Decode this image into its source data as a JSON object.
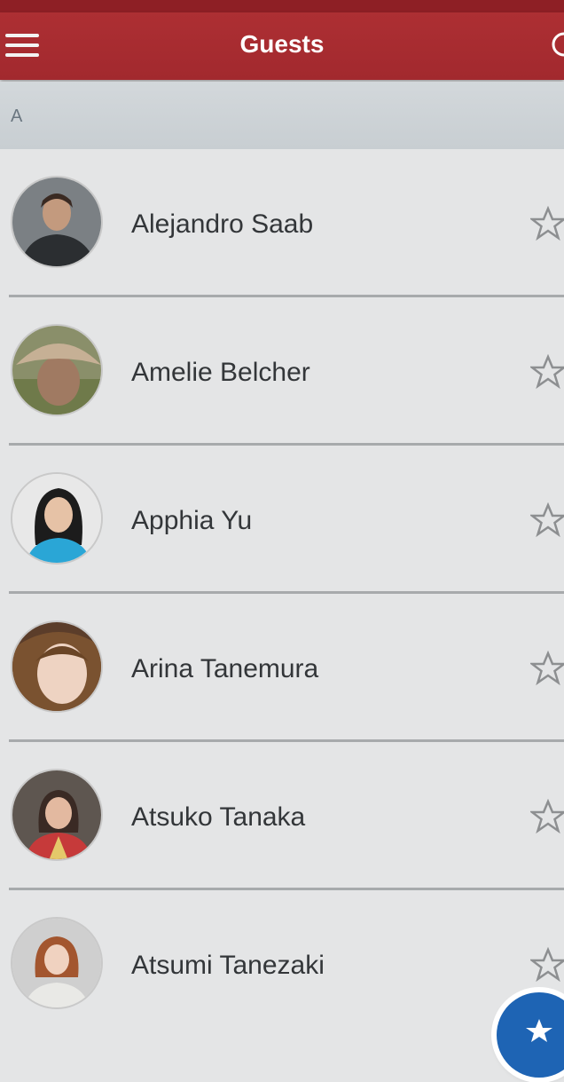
{
  "header": {
    "title": "Guests",
    "menu_icon": "hamburger-menu-icon",
    "right_icon": "search-icon"
  },
  "section": {
    "letter": "A"
  },
  "guests": [
    {
      "name": "Alejandro Saab",
      "favorite_icon": "star-outline-icon"
    },
    {
      "name": "Amelie Belcher",
      "favorite_icon": "star-outline-icon"
    },
    {
      "name": "Apphia Yu",
      "favorite_icon": "star-outline-icon"
    },
    {
      "name": "Arina Tanemura",
      "favorite_icon": "star-outline-icon"
    },
    {
      "name": "Atsuko Tanaka",
      "favorite_icon": "star-outline-icon"
    },
    {
      "name": "Atsumi Tanezaki",
      "favorite_icon": "star-outline-icon"
    }
  ],
  "fab": {
    "icon": "star-icon"
  },
  "colors": {
    "navbar": "#a8292e",
    "section_header": "#cfd4d7",
    "fab": "#1e64b4",
    "background": "#e4e5e6"
  }
}
